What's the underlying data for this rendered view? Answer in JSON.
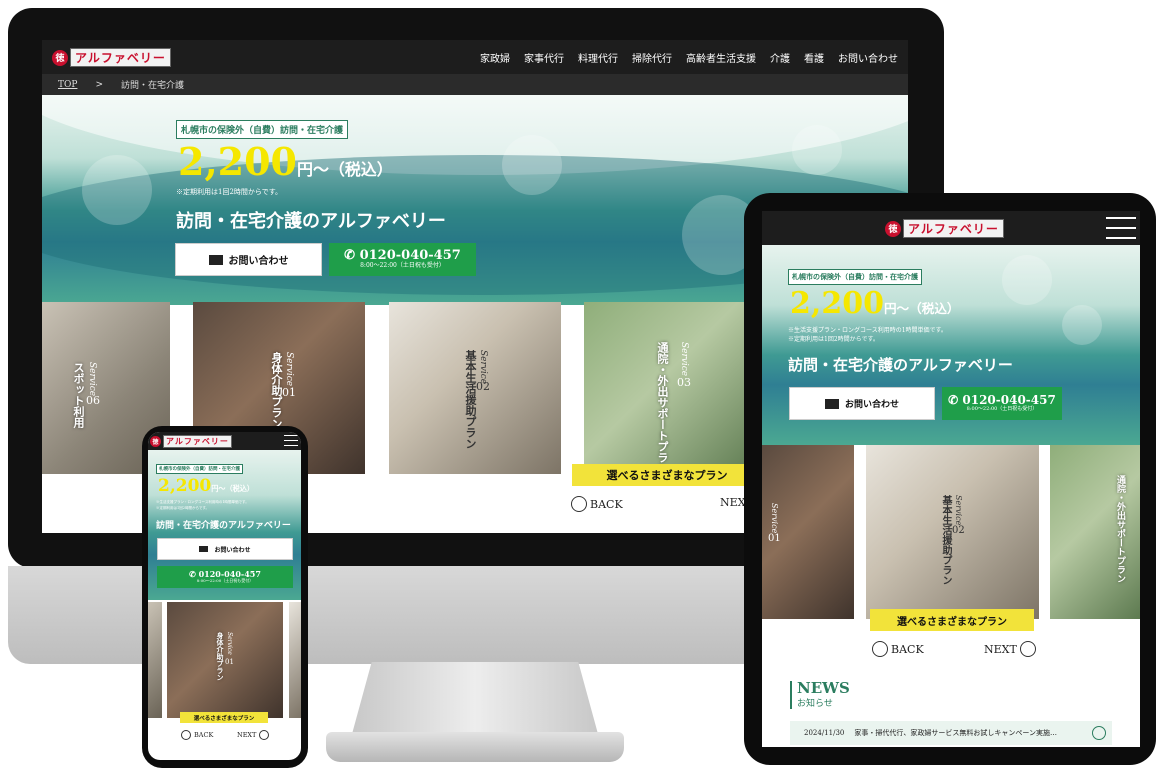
{
  "site": {
    "logo_mark": "徳",
    "logo_text": "アルファベリー"
  },
  "nav": {
    "items": [
      "家政婦",
      "家事代行",
      "料理代行",
      "掃除代行",
      "高齢者生活支援",
      "介護",
      "看護",
      "お問い合わせ"
    ]
  },
  "breadcrumb": {
    "top": "TOP",
    "separator": ">",
    "current": "訪問・在宅介護"
  },
  "hero": {
    "tag": "札幌市の保険外（自費）訪問・在宅介護",
    "price": "2,200",
    "price_suffix": "円〜（税込）",
    "note_plan": "※生活支援プラン・ロングコース利用時の1時間単価です。",
    "note_min": "※定期利用は1回2時間からです。",
    "headline": "訪問・在宅介護のアルファベリー",
    "contact_label": "お問い合わせ",
    "tel_number": "0120-040-457",
    "tel_hours": "8:00〜22:00（土日祝も受付）"
  },
  "services": {
    "en": "Service",
    "items": [
      {
        "no": "01",
        "label": "身体介助プラン"
      },
      {
        "no": "02",
        "label": "基本生活援助プラン"
      },
      {
        "no": "03",
        "label": "通院・外出サポートプラン"
      },
      {
        "no": "06",
        "label": "スポット利用"
      }
    ],
    "band": "選べるさまざまなプラン",
    "back": "BACK",
    "next": "NEXT"
  },
  "news": {
    "heading": "NEWS",
    "sub": "お知らせ",
    "items": [
      {
        "date": "2024/11/30",
        "title": "家事・掃代代行、家政婦サービス無料お試しキャンペーン実施…"
      }
    ]
  },
  "colors": {
    "accent_yellow": "#f5e700",
    "tel_green": "#1f9e4a",
    "brand_red": "#c8102e",
    "tag_green": "#2b7d5f",
    "band_yellow": "#f2e33a"
  }
}
